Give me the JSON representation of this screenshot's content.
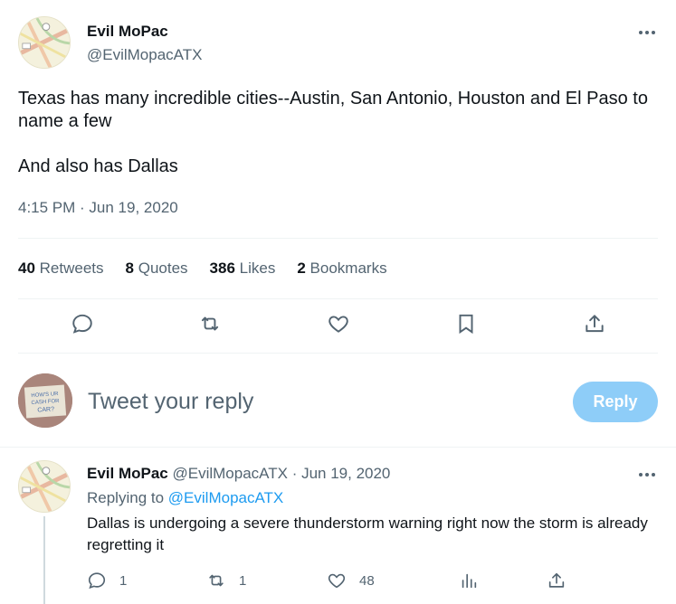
{
  "tweet": {
    "author_name": "Evil MoPac",
    "author_handle": "@EvilMopacATX",
    "text_line1": "Texas has many incredible cities--Austin, San Antonio, Houston and El Paso to name a few",
    "text_line2": "And also has Dallas",
    "timestamp": "4:15 PM · Jun 19, 2020",
    "stats": {
      "retweets_count": "40",
      "retweets_label": "Retweets",
      "quotes_count": "8",
      "quotes_label": "Quotes",
      "likes_count": "386",
      "likes_label": "Likes",
      "bookmarks_count": "2",
      "bookmarks_label": "Bookmarks"
    },
    "icons": [
      "reply-icon",
      "retweet-icon",
      "like-icon",
      "bookmark-icon",
      "share-icon"
    ]
  },
  "composer": {
    "placeholder": "Tweet your reply",
    "reply_button": "Reply",
    "avatar_text": "HOW'S UR CASH FOR CAR?"
  },
  "reply": {
    "author_name": "Evil MoPac",
    "author_handle_date": "@EvilMopacATX · Jun 19, 2020",
    "replying_to_label": "Replying to",
    "replying_to_handle": "@EvilMopacATX",
    "text": "Dallas is undergoing a severe thunderstorm warning right now the storm is already regretting it",
    "reply_count": "1",
    "retweet_count": "1",
    "like_count": "48",
    "icons": [
      "reply-icon",
      "retweet-icon",
      "like-icon",
      "views-icon",
      "share-icon"
    ]
  },
  "colors": {
    "accent": "#1d9bf0",
    "reply_button_disabled": "#8ecdf8",
    "text": "#0f1419",
    "muted": "#536471"
  }
}
